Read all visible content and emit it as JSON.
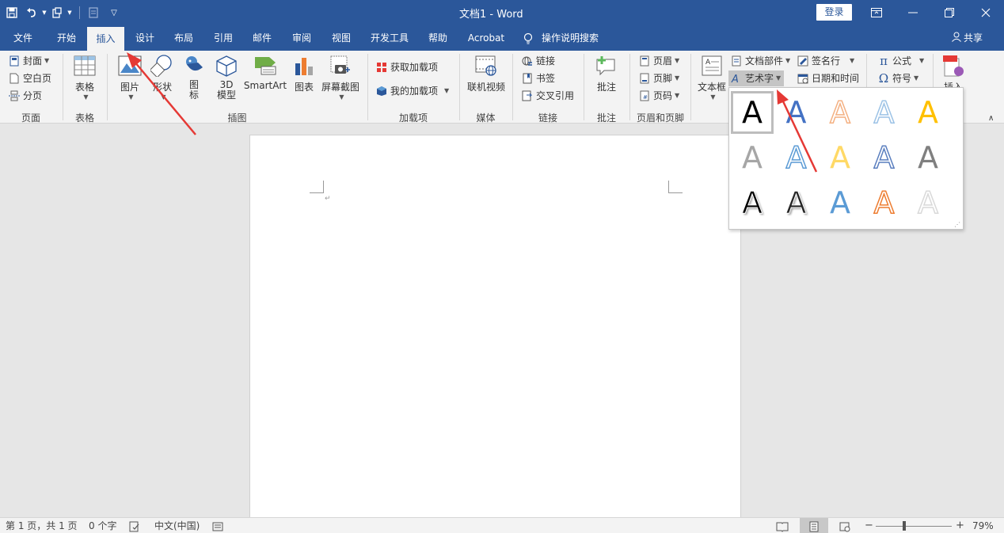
{
  "title_bar": {
    "title": "文档1  -  Word",
    "login": "登录",
    "restore_icon": "ribbon-display-icon",
    "min_icon": "minimize-icon",
    "max_icon": "restore-icon",
    "close_icon": "close-icon"
  },
  "tabs": [
    "文件",
    "开始",
    "插入",
    "设计",
    "布局",
    "引用",
    "邮件",
    "审阅",
    "视图",
    "开发工具",
    "帮助",
    "Acrobat"
  ],
  "active_tab": "插入",
  "tell_me": "操作说明搜索",
  "share": "共享",
  "ribbon": {
    "pages": {
      "cover": "封面",
      "blank": "空白页",
      "break": "分页",
      "label": "页面"
    },
    "tables": {
      "table": "表格",
      "label": "表格"
    },
    "illustrations": {
      "picture": "图片",
      "shapes": "形状",
      "icons": "图\n标",
      "model3d": "3D\n模型",
      "smartart": "SmartArt",
      "chart": "图表",
      "screenshot": "屏幕截图",
      "label": "插图"
    },
    "addins": {
      "get": "获取加载项",
      "my": "我的加载项",
      "label": "加载项"
    },
    "media": {
      "online_video": "联机视频",
      "label": "媒体"
    },
    "links": {
      "link": "链接",
      "bookmark": "书签",
      "cross_ref": "交叉引用",
      "label": "链接"
    },
    "comments": {
      "comment": "批注",
      "label": "批注"
    },
    "header_footer": {
      "header": "页眉",
      "footer": "页脚",
      "page_number": "页码",
      "label": "页眉和页脚"
    },
    "text": {
      "textbox": "文本框",
      "quick_parts": "文档部件",
      "wordart": "艺术字",
      "signature": "签名行",
      "datetime": "日期和时间"
    },
    "symbols": {
      "equation": "公式",
      "symbol": "符号"
    },
    "insert": "插入"
  },
  "wordart_gallery": {
    "glyph": "A",
    "rows": [
      [
        "#000000",
        "#4472c4",
        "#f4b183",
        "#9dc3e6",
        "#ffc000"
      ],
      [
        "#a6a6a6",
        "#5b9bd5",
        "#ffd966",
        "#5b7fbf",
        "#7f7f7f"
      ],
      [
        "#000000",
        "#262626",
        "#5b9bd5",
        "#ed7d31",
        "#d9d9d9"
      ]
    ]
  },
  "document": {
    "paragraph_mark": "↵"
  },
  "status_bar": {
    "page": "第 1 页，共 1 页",
    "words": "0 个字",
    "language": "中文(中国)",
    "zoom": "79%",
    "zoom_fraction": 0.37
  },
  "colors": {
    "word_blue": "#2b579a",
    "arrow_red": "#e53935"
  }
}
